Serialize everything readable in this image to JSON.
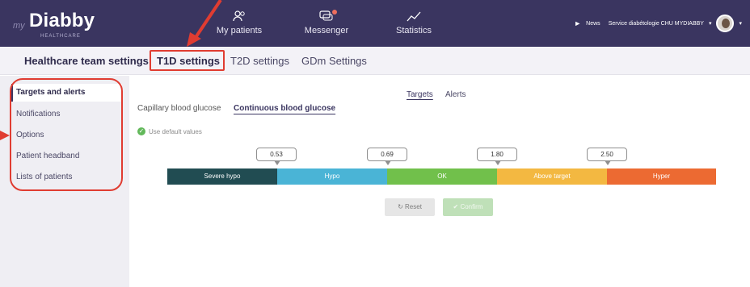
{
  "topbar": {
    "logo_prefix": "my",
    "logo_name": "Diabby",
    "logo_sub": "HEALTHCARE",
    "nav": [
      {
        "label": "My patients",
        "icon": "patients-icon"
      },
      {
        "label": "Messenger",
        "icon": "messenger-icon"
      },
      {
        "label": "Statistics",
        "icon": "statistics-icon"
      }
    ],
    "news_label": "News",
    "service_label": "Service diabétologie CHU MYDIABBY",
    "bg_color": "#3a3560"
  },
  "settings": {
    "title": "Healthcare team settings:",
    "tabs": [
      "T1D settings",
      "T2D settings",
      "GDm Settings"
    ]
  },
  "sidebar": {
    "items": [
      "Targets and alerts",
      "Notifications",
      "Options",
      "Patient headband",
      "Lists of patients"
    ]
  },
  "main": {
    "tabs": [
      "Targets",
      "Alerts"
    ],
    "subtabs": [
      "Capillary blood glucose",
      "Continuous blood glucose"
    ],
    "default_label": "Use default values",
    "thresholds": [
      "0.53",
      "0.69",
      "1.80",
      "2.50"
    ],
    "ranges": [
      {
        "label": "Severe hypo",
        "color": "#214c52"
      },
      {
        "label": "Hypo",
        "color": "#4ab4d6"
      },
      {
        "label": "OK",
        "color": "#71c04b"
      },
      {
        "label": "Above target",
        "color": "#f3b841"
      },
      {
        "label": "Hyper",
        "color": "#ec6a32"
      }
    ],
    "reset_label": "Reset",
    "confirm_label": "Confirm"
  }
}
